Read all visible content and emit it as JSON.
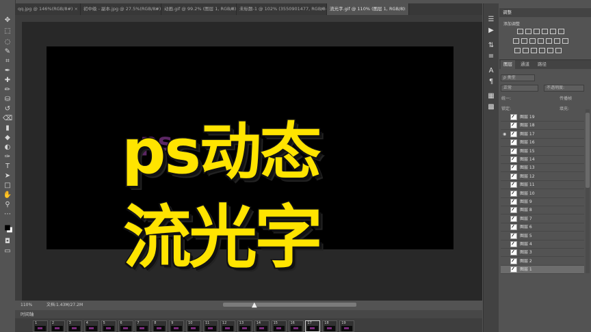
{
  "tabs": [
    {
      "label": "qq.jpg @ 146%(RGB/8#)",
      "active": false
    },
    {
      "label": "初中级 - 副本.jpg @ 27.5%(RGB/8#)",
      "active": false
    },
    {
      "label": "动画.gif @ 99.2% (图层 1, RGB/8)",
      "active": false
    },
    {
      "label": "未标题-1 @ 102% (3550901477, RGB/8#)",
      "active": false
    },
    {
      "label": "流光字.gif @ 110% (图层 1, RGB/8)",
      "active": true
    }
  ],
  "tab_close": "×",
  "overlay": {
    "line1": "ps动态",
    "line2": "流光字",
    "ghost": "ps"
  },
  "status": {
    "zoom": "110%",
    "doc": "文档:1.43M/27.2M"
  },
  "timeline": {
    "title": "时间轴",
    "frames": [
      "1",
      "2",
      "3",
      "4",
      "5",
      "6",
      "7",
      "8",
      "9",
      "10",
      "11",
      "12",
      "13",
      "14",
      "15",
      "16",
      "17",
      "18",
      "19"
    ],
    "selected": "17"
  },
  "adjustments": {
    "title": "调整",
    "subtitle": "添加调整"
  },
  "layers": {
    "tabs": [
      "图层",
      "通道",
      "路径"
    ],
    "filter_label": "ρ 类型",
    "blend_mode": "正常",
    "opacity_label": "不透明度:",
    "lock_label": "锁定:",
    "fill_label": "填充:",
    "unify_label": "统一:",
    "propagate_label": "传播帧",
    "items": [
      {
        "name": "图层 19",
        "visible": false,
        "selected": false
      },
      {
        "name": "图层 18",
        "visible": false,
        "selected": false
      },
      {
        "name": "图层 17",
        "visible": true,
        "selected": false
      },
      {
        "name": "图层 16",
        "visible": false,
        "selected": false
      },
      {
        "name": "图层 15",
        "visible": false,
        "selected": false
      },
      {
        "name": "图层 14",
        "visible": false,
        "selected": false
      },
      {
        "name": "图层 13",
        "visible": false,
        "selected": false
      },
      {
        "name": "图层 12",
        "visible": false,
        "selected": false
      },
      {
        "name": "图层 11",
        "visible": false,
        "selected": false
      },
      {
        "name": "图层 10",
        "visible": false,
        "selected": false
      },
      {
        "name": "图层 9",
        "visible": false,
        "selected": false
      },
      {
        "name": "图层 8",
        "visible": false,
        "selected": false
      },
      {
        "name": "图层 7",
        "visible": false,
        "selected": false
      },
      {
        "name": "图层 6",
        "visible": false,
        "selected": false
      },
      {
        "name": "图层 5",
        "visible": false,
        "selected": false
      },
      {
        "name": "图层 4",
        "visible": false,
        "selected": false
      },
      {
        "name": "图层 3",
        "visible": false,
        "selected": false
      },
      {
        "name": "图层 2",
        "visible": false,
        "selected": false
      },
      {
        "name": "图层 1",
        "visible": false,
        "selected": true
      }
    ]
  },
  "tools": [
    "move-icon",
    "marquee-icon",
    "lasso-icon",
    "quick-select-icon",
    "crop-icon",
    "eyedropper-icon",
    "healing-icon",
    "brush-icon",
    "stamp-icon",
    "history-brush-icon",
    "eraser-icon",
    "gradient-icon",
    "blur-icon",
    "dodge-icon",
    "pen-icon",
    "type-icon",
    "path-select-icon",
    "shape-icon",
    "hand-icon",
    "zoom-icon",
    "more-icon",
    "color-swatch-icon",
    "quickmask-icon",
    "screen-mode-icon"
  ],
  "colors": {
    "text_fill": "#ffe400",
    "selected_layer": "#6d6d6d",
    "panel_bg": "#535353"
  }
}
